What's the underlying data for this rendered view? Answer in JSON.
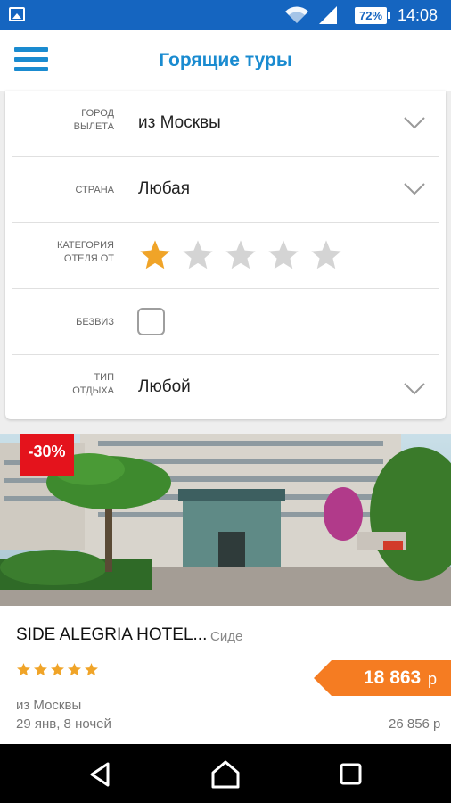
{
  "status_bar": {
    "battery": "72%",
    "time": "14:08",
    "icons": [
      "image-notification-icon",
      "wifi-icon",
      "signal-icon",
      "battery-icon"
    ]
  },
  "app_bar": {
    "title": "Горящие туры",
    "menu_icon": "hamburger-menu-icon"
  },
  "filters": {
    "departure": {
      "label_line1": "Город",
      "label_line2": "вылета",
      "value": "из Москвы"
    },
    "country": {
      "label": "Страна",
      "value": "Любая"
    },
    "category": {
      "label_line1": "Категория",
      "label_line2": "отеля от",
      "rating": 1,
      "max": 5
    },
    "visa_free": {
      "label": "Безвиз",
      "checked": false
    },
    "rest_type": {
      "label_line1": "Тип",
      "label_line2": "отдыха",
      "value": "Любой"
    }
  },
  "hotel": {
    "discount": "-30%",
    "name": "SIDE ALEGRIA HOTEL...",
    "city": "Сиде",
    "stars": 5,
    "price": "18 863",
    "currency": "р",
    "old_price": "26 856 р",
    "departure": "из Москвы",
    "dates": "29 янв, 8 ночей"
  },
  "colors": {
    "status_bar": "#1565c0",
    "accent": "#1a8bd0",
    "star_active": "#f0a428",
    "star_inactive": "#d4d4d4",
    "discount": "#e4131c",
    "price_tag": "#f57c22"
  },
  "nav_bar": {
    "buttons": [
      "back-icon",
      "home-icon",
      "recents-icon"
    ]
  }
}
